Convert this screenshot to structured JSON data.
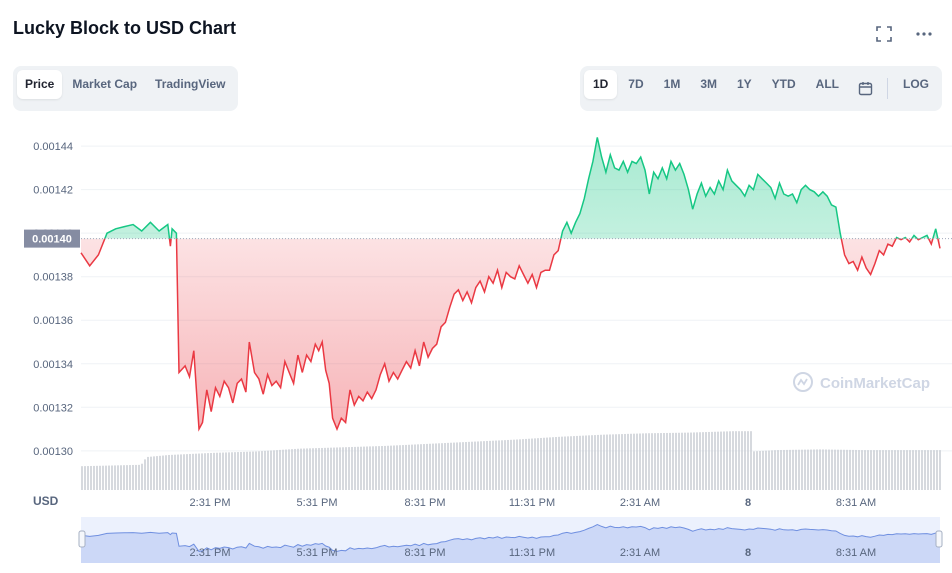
{
  "header": {
    "title": "Lucky Block to USD Chart",
    "icons": [
      "fullscreen-icon",
      "more-icon"
    ]
  },
  "tabs": [
    {
      "label": "Price",
      "active": true
    },
    {
      "label": "Market Cap",
      "active": false
    },
    {
      "label": "TradingView",
      "active": false
    }
  ],
  "ranges": [
    {
      "label": "1D",
      "active": true
    },
    {
      "label": "7D",
      "active": false
    },
    {
      "label": "1M",
      "active": false
    },
    {
      "label": "3M",
      "active": false
    },
    {
      "label": "1Y",
      "active": false
    },
    {
      "label": "YTD",
      "active": false
    },
    {
      "label": "ALL",
      "active": false
    }
  ],
  "log_label": "LOG",
  "watermark": "CoinMarketCap",
  "colors": {
    "up": "#16c784",
    "down": "#ea3943",
    "grid": "#eff2f5",
    "volume": "#c8ccd3",
    "navigator": "#dde6fb"
  },
  "chart_data": {
    "type": "line",
    "currency_label": "USD",
    "current_label": "0.00140",
    "baseline": 0.0013975,
    "y_ticks": [
      "0.00144",
      "0.00142",
      "0.00140",
      "0.00138",
      "0.00136",
      "0.00134",
      "0.00132",
      "0.00130"
    ],
    "ylim": [
      0.001282,
      0.001452
    ],
    "x_ticks": [
      "2:31 PM",
      "5:31 PM",
      "8:31 PM",
      "11:31 PM",
      "2:31 AM",
      "8",
      "8:31 AM"
    ],
    "grid": true,
    "price": [
      [
        0,
        0.001391
      ],
      [
        1,
        0.001385
      ],
      [
        2,
        0.00139
      ],
      [
        3,
        0.0014
      ],
      [
        4,
        0.001402
      ],
      [
        5,
        0.001403
      ],
      [
        6,
        0.001404
      ],
      [
        7,
        0.001401
      ],
      [
        8,
        0.001405
      ],
      [
        9,
        0.001401
      ],
      [
        10,
        0.001404
      ],
      [
        10.3,
        0.001394
      ],
      [
        10.5,
        0.001402
      ],
      [
        11,
        0.0014
      ],
      [
        11.3,
        0.001336
      ],
      [
        12,
        0.001339
      ],
      [
        12.5,
        0.001334
      ],
      [
        13,
        0.001346
      ],
      [
        13.6,
        0.00131
      ],
      [
        14,
        0.001313
      ],
      [
        14.5,
        0.001328
      ],
      [
        15,
        0.001318
      ],
      [
        15.5,
        0.001329
      ],
      [
        16,
        0.001325
      ],
      [
        16.5,
        0.001332
      ],
      [
        17,
        0.001329
      ],
      [
        17.5,
        0.001322
      ],
      [
        18,
        0.001331
      ],
      [
        18.5,
        0.001333
      ],
      [
        19,
        0.001327
      ],
      [
        19.4,
        0.00135
      ],
      [
        20,
        0.001336
      ],
      [
        20.5,
        0.001333
      ],
      [
        21,
        0.001326
      ],
      [
        21.5,
        0.001335
      ],
      [
        22,
        0.00133
      ],
      [
        22.5,
        0.001332
      ],
      [
        23,
        0.001329
      ],
      [
        23.5,
        0.001341
      ],
      [
        24,
        0.001336
      ],
      [
        24.5,
        0.001331
      ],
      [
        25,
        0.001344
      ],
      [
        25.5,
        0.001336
      ],
      [
        26,
        0.001344
      ],
      [
        26.5,
        0.001341
      ],
      [
        27,
        0.001349
      ],
      [
        27.4,
        0.001346
      ],
      [
        27.8,
        0.00135
      ],
      [
        28.2,
        0.001337
      ],
      [
        28.6,
        0.001331
      ],
      [
        29,
        0.001315
      ],
      [
        29.5,
        0.00131
      ],
      [
        30,
        0.001315
      ],
      [
        30.5,
        0.001313
      ],
      [
        31,
        0.001328
      ],
      [
        31.5,
        0.001321
      ],
      [
        32,
        0.001325
      ],
      [
        32.5,
        0.001323
      ],
      [
        33,
        0.001327
      ],
      [
        33.5,
        0.001324
      ],
      [
        34,
        0.001328
      ],
      [
        34.5,
        0.001335
      ],
      [
        35,
        0.00134
      ],
      [
        35.5,
        0.001332
      ],
      [
        36,
        0.001336
      ],
      [
        36.5,
        0.001333
      ],
      [
        37,
        0.001337
      ],
      [
        37.5,
        0.001341
      ],
      [
        38,
        0.001338
      ],
      [
        38.5,
        0.001346
      ],
      [
        39,
        0.001339
      ],
      [
        39.5,
        0.00135
      ],
      [
        40,
        0.001343
      ],
      [
        40.5,
        0.001347
      ],
      [
        41,
        0.001349
      ],
      [
        41.5,
        0.001357
      ],
      [
        42,
        0.001359
      ],
      [
        42.5,
        0.001366
      ],
      [
        43,
        0.001372
      ],
      [
        43.5,
        0.001374
      ],
      [
        44,
        0.001369
      ],
      [
        44.5,
        0.001373
      ],
      [
        45,
        0.001368
      ],
      [
        45.5,
        0.001375
      ],
      [
        46,
        0.001378
      ],
      [
        46.5,
        0.001373
      ],
      [
        47,
        0.00138
      ],
      [
        47.5,
        0.001377
      ],
      [
        48,
        0.001383
      ],
      [
        48.5,
        0.001375
      ],
      [
        49,
        0.001382
      ],
      [
        49.5,
        0.00138
      ],
      [
        50,
        0.001379
      ],
      [
        50.5,
        0.001385
      ],
      [
        51,
        0.001381
      ],
      [
        51.5,
        0.001377
      ],
      [
        52,
        0.001381
      ],
      [
        52.5,
        0.001375
      ],
      [
        53,
        0.001382
      ],
      [
        53.5,
        0.001383
      ],
      [
        54,
        0.001383
      ],
      [
        54.5,
        0.00139
      ],
      [
        55,
        0.001392
      ],
      [
        55.5,
        0.001401
      ],
      [
        56,
        0.001405
      ],
      [
        56.5,
        0.0014
      ],
      [
        57,
        0.001405
      ],
      [
        57.5,
        0.001409
      ],
      [
        58,
        0.001416
      ],
      [
        58.5,
        0.001425
      ],
      [
        59,
        0.001433
      ],
      [
        59.5,
        0.001444
      ],
      [
        60,
        0.001435
      ],
      [
        60.5,
        0.001428
      ],
      [
        61,
        0.001436
      ],
      [
        61.5,
        0.00143
      ],
      [
        62,
        0.001429
      ],
      [
        62.5,
        0.001433
      ],
      [
        63,
        0.001428
      ],
      [
        63.5,
        0.001433
      ],
      [
        64,
        0.001432
      ],
      [
        64.5,
        0.001435
      ],
      [
        65,
        0.001429
      ],
      [
        65.5,
        0.001418
      ],
      [
        66,
        0.001428
      ],
      [
        66.5,
        0.001425
      ],
      [
        67,
        0.00143
      ],
      [
        67.5,
        0.001425
      ],
      [
        68,
        0.001433
      ],
      [
        68.5,
        0.001429
      ],
      [
        69,
        0.001432
      ],
      [
        69.5,
        0.001427
      ],
      [
        70,
        0.00142
      ],
      [
        70.5,
        0.001411
      ],
      [
        71,
        0.001418
      ],
      [
        71.5,
        0.001423
      ],
      [
        72,
        0.001417
      ],
      [
        72.5,
        0.001421
      ],
      [
        73,
        0.001418
      ],
      [
        73.5,
        0.001424
      ],
      [
        74,
        0.00142
      ],
      [
        74.5,
        0.001429
      ],
      [
        75,
        0.001424
      ],
      [
        75.5,
        0.001422
      ],
      [
        76,
        0.00142
      ],
      [
        76.5,
        0.001417
      ],
      [
        77,
        0.001422
      ],
      [
        77.5,
        0.00142
      ],
      [
        78,
        0.001427
      ],
      [
        78.5,
        0.001425
      ],
      [
        79,
        0.001423
      ],
      [
        79.5,
        0.001421
      ],
      [
        80,
        0.001416
      ],
      [
        80.5,
        0.001423
      ],
      [
        81,
        0.001418
      ],
      [
        81.5,
        0.001417
      ],
      [
        82,
        0.001418
      ],
      [
        82.5,
        0.001414
      ],
      [
        83,
        0.00142
      ],
      [
        83.5,
        0.001422
      ],
      [
        84,
        0.00142
      ],
      [
        84.5,
        0.001419
      ],
      [
        85,
        0.001417
      ],
      [
        85.5,
        0.001419
      ],
      [
        86,
        0.001417
      ],
      [
        86.5,
        0.001413
      ],
      [
        87,
        0.001412
      ],
      [
        87.5,
        0.0014
      ],
      [
        88,
        0.00139
      ],
      [
        88.5,
        0.001386
      ],
      [
        89,
        0.001387
      ],
      [
        89.5,
        0.001383
      ],
      [
        90,
        0.001389
      ],
      [
        90.5,
        0.001384
      ],
      [
        91,
        0.001381
      ],
      [
        91.5,
        0.001386
      ],
      [
        92,
        0.001392
      ],
      [
        92.5,
        0.00139
      ],
      [
        93,
        0.001395
      ],
      [
        93.5,
        0.001394
      ],
      [
        94,
        0.001398
      ],
      [
        94.5,
        0.001397
      ],
      [
        95,
        0.001398
      ],
      [
        95.5,
        0.001396
      ],
      [
        96,
        0.001399
      ],
      [
        96.5,
        0.001397
      ],
      [
        97,
        0.001398
      ],
      [
        97.5,
        0.001399
      ],
      [
        98,
        0.001395
      ],
      [
        98.5,
        0.001402
      ],
      [
        99,
        0.001393
      ]
    ],
    "volume_steps": [
      [
        0,
        0.34
      ],
      [
        6.8,
        0.36
      ],
      [
        7.1,
        0.4
      ],
      [
        7.4,
        0.47
      ],
      [
        10,
        0.5
      ],
      [
        15,
        0.53
      ],
      [
        20,
        0.55
      ],
      [
        25,
        0.59
      ],
      [
        30,
        0.61
      ],
      [
        35,
        0.63
      ],
      [
        40,
        0.66
      ],
      [
        45,
        0.69
      ],
      [
        50,
        0.72
      ],
      [
        55,
        0.76
      ],
      [
        60,
        0.79
      ],
      [
        65,
        0.81
      ],
      [
        70,
        0.82
      ],
      [
        75,
        0.84
      ],
      [
        77.2,
        0.55
      ],
      [
        80,
        0.57
      ],
      [
        85,
        0.58
      ],
      [
        90,
        0.57
      ],
      [
        95,
        0.57
      ],
      [
        100,
        0.57
      ]
    ]
  }
}
